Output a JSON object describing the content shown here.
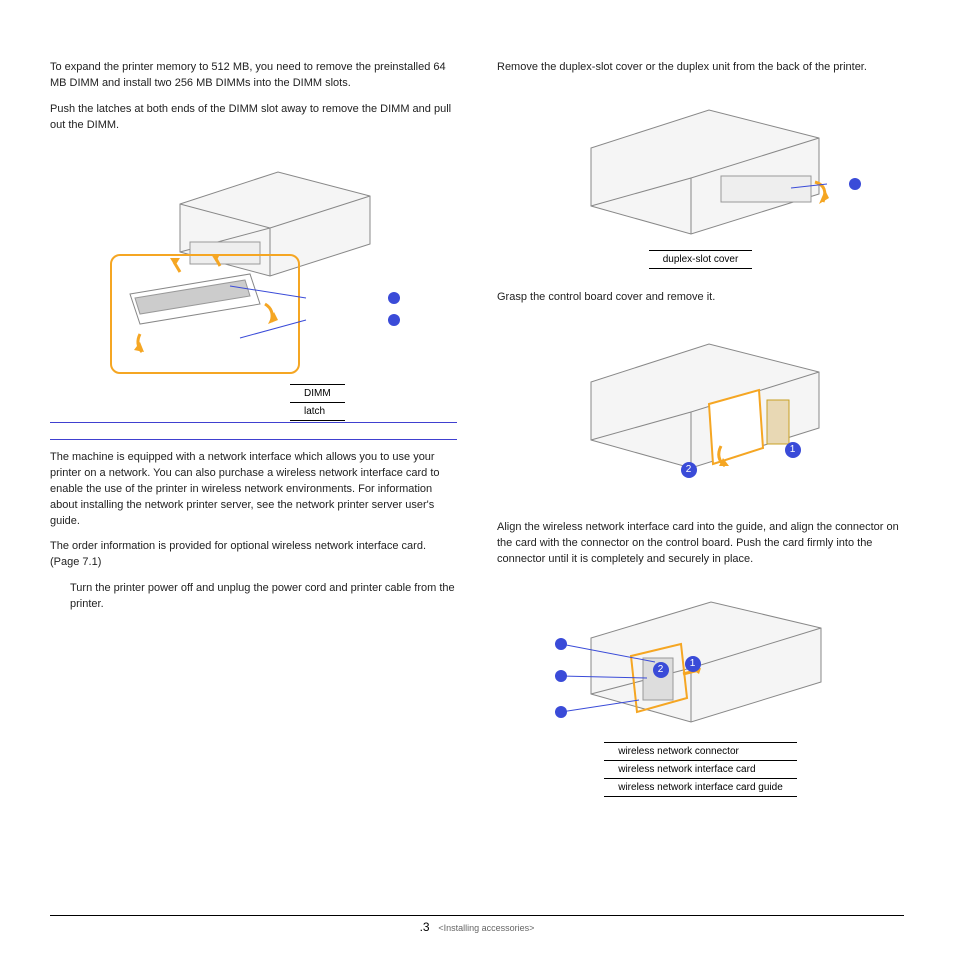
{
  "left": {
    "p1": "To expand the printer memory to 512 MB, you need to remove the preinstalled 64 MB DIMM and install two 256 MB DIMMs into the DIMM slots.",
    "p2": "Push the latches at both ends of the DIMM slot away to remove the DIMM and pull out the DIMM.",
    "dimm_labels": {
      "r1": "DIMM",
      "r2": "latch"
    },
    "p3": "The machine is equipped with a network interface which allows you to use your printer on a network. You can also purchase a wireless network interface card to enable the use of the printer in wireless network environments. For information about installing the network printer server, see the network printer server user's guide.",
    "p4": "The order information is provided for optional wireless network interface card. (Page 7.1)",
    "p5": "Turn the printer power off and unplug the power cord and printer cable from the printer."
  },
  "right": {
    "p1": "Remove the duplex-slot cover or the duplex unit from the back of the printer.",
    "duplex_label": "duplex-slot cover",
    "p2": "Grasp the control board cover and remove it.",
    "p3": "Align the wireless network interface card into the guide, and align the connector on the card with the connector on the control board. Push the card firmly into the connector until it is completely and securely in place.",
    "wireless_labels": {
      "r1": "wireless network connector",
      "r2": "wireless network interface card",
      "r3": "wireless network interface card guide"
    },
    "callouts": {
      "one": "1",
      "two": "2"
    }
  },
  "footer": {
    "page": ".3",
    "section": "<Installing accessories>"
  }
}
